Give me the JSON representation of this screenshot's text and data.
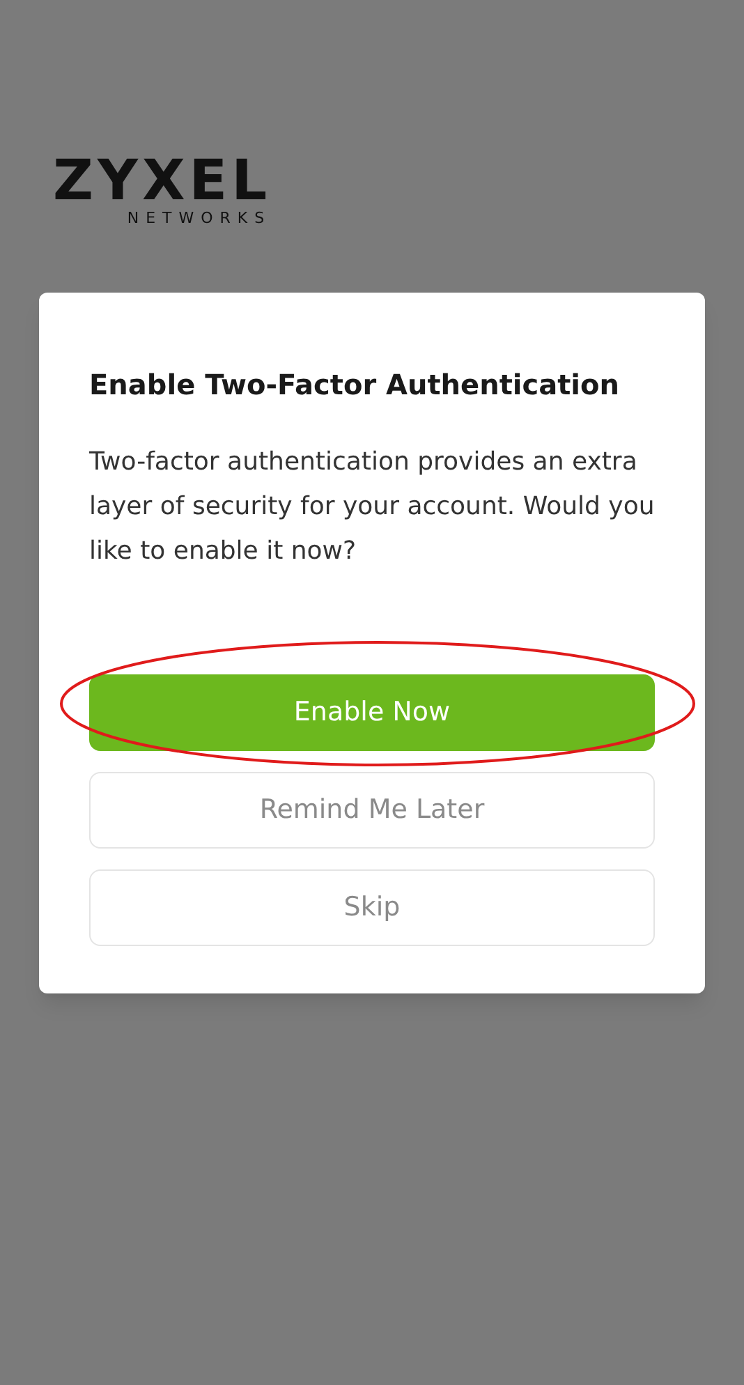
{
  "logo": {
    "wordmark": "ZYXEL",
    "subtitle": "NETWORKS"
  },
  "dialog": {
    "title": "Enable Two-Factor Authentication",
    "message": "Two-factor authentication provides an extra layer of security for your account. Would you like to enable it now?",
    "buttons": [
      {
        "label": "Enable Now",
        "kind": "primary",
        "circled": true
      },
      {
        "label": "Remind Me Later",
        "kind": "secondary",
        "circled": false
      },
      {
        "label": "Skip",
        "kind": "secondary",
        "circled": false
      }
    ]
  }
}
